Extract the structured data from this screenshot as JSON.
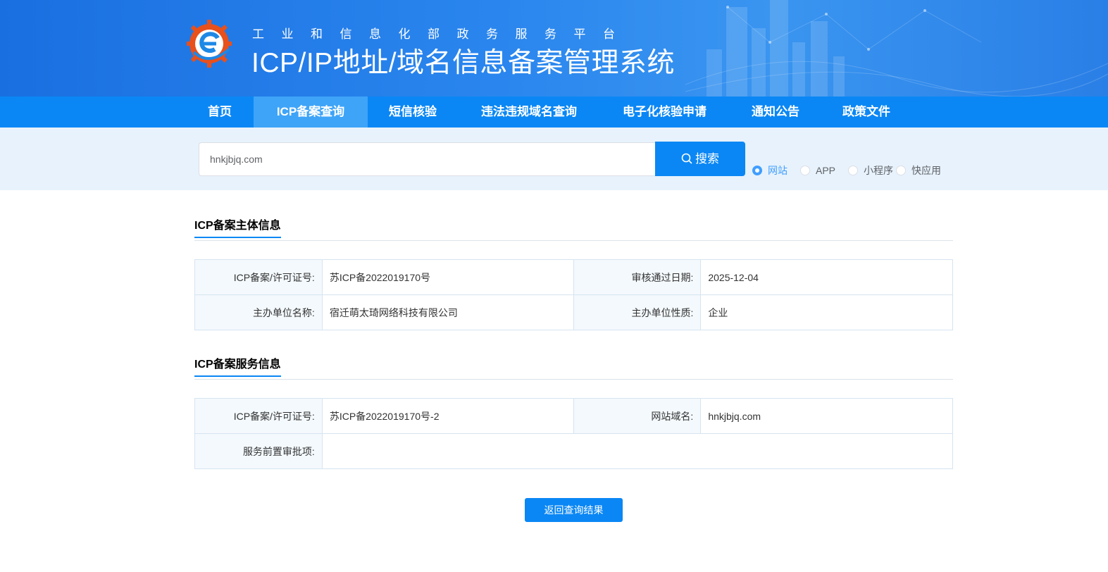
{
  "header": {
    "subtitle": "工业和信息化部政务服务平台",
    "title": "ICP/IP地址/域名信息备案管理系统"
  },
  "nav": {
    "items": [
      {
        "label": "首页"
      },
      {
        "label": "ICP备案查询"
      },
      {
        "label": "短信核验"
      },
      {
        "label": "违法违规域名查询"
      },
      {
        "label": "电子化核验申请"
      },
      {
        "label": "通知公告"
      },
      {
        "label": "政策文件"
      }
    ],
    "active_index": 1
  },
  "search": {
    "value": "hnkjbjq.com",
    "button_label": "搜索",
    "types": [
      {
        "label": "网站",
        "checked": true
      },
      {
        "label": "APP",
        "checked": false
      },
      {
        "label": "小程序",
        "checked": false
      },
      {
        "label": "快应用",
        "checked": false
      }
    ]
  },
  "subject": {
    "title": "ICP备案主体信息",
    "license_label": "ICP备案/许可证号:",
    "license_value": "苏ICP备2022019170号",
    "date_label": "审核通过日期:",
    "date_value": "2025-12-04",
    "org_label": "主办单位名称:",
    "org_value": "宿迁萌太琦网络科技有限公司",
    "nature_label": "主办单位性质:",
    "nature_value": "企业"
  },
  "service": {
    "title": "ICP备案服务信息",
    "license_label": "ICP备案/许可证号:",
    "license_value": "苏ICP备2022019170号-2",
    "domain_label": "网站域名:",
    "domain_value": "hnkjbjq.com",
    "approval_label": "服务前置审批项:",
    "approval_value": ""
  },
  "back_button_label": "返回查询结果",
  "colors": {
    "primary": "#0a87f5",
    "nav_active": "#3ea4f8",
    "search_band": "#e7f2fc",
    "radio_checked": "#409eff"
  }
}
